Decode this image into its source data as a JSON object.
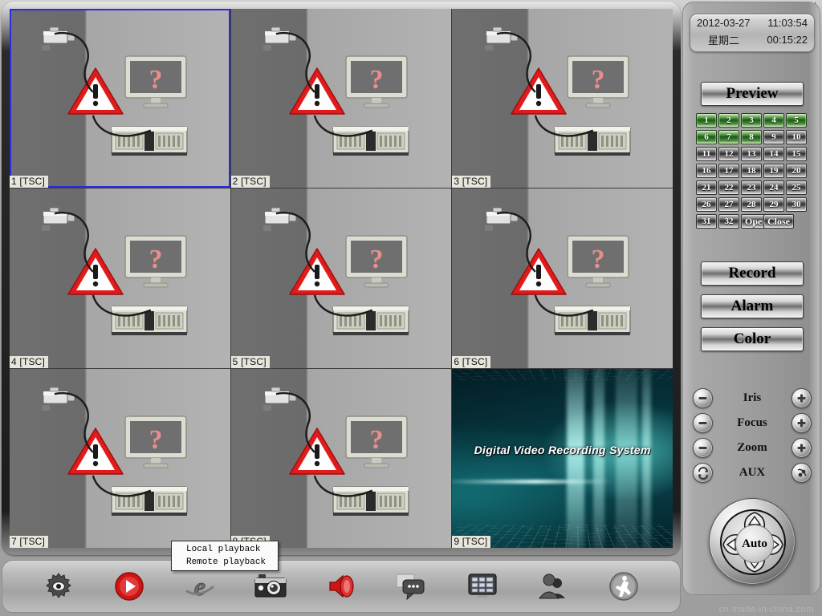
{
  "window": {
    "minimize_icon": "minimize-icon"
  },
  "clock": {
    "date": "2012-03-27",
    "time": "11:03:54",
    "weekday": "星期二",
    "elapsed": "00:15:22"
  },
  "sidebar": {
    "preview_label": "Preview",
    "record_label": "Record",
    "alarm_label": "Alarm",
    "color_label": "Color",
    "channels": [
      {
        "label": "1",
        "active": true
      },
      {
        "label": "2",
        "active": true
      },
      {
        "label": "3",
        "active": true
      },
      {
        "label": "4",
        "active": true
      },
      {
        "label": "5",
        "active": true
      },
      {
        "label": "6",
        "active": true
      },
      {
        "label": "7",
        "active": true
      },
      {
        "label": "8",
        "active": true
      },
      {
        "label": "9",
        "active": false
      },
      {
        "label": "10",
        "active": false
      },
      {
        "label": "11",
        "active": false
      },
      {
        "label": "12",
        "active": false
      },
      {
        "label": "13",
        "active": false
      },
      {
        "label": "14",
        "active": false
      },
      {
        "label": "15",
        "active": false
      },
      {
        "label": "16",
        "active": false
      },
      {
        "label": "17",
        "active": false
      },
      {
        "label": "18",
        "active": false
      },
      {
        "label": "19",
        "active": false
      },
      {
        "label": "20",
        "active": false
      },
      {
        "label": "21",
        "active": false
      },
      {
        "label": "22",
        "active": false
      },
      {
        "label": "23",
        "active": false
      },
      {
        "label": "24",
        "active": false
      },
      {
        "label": "25",
        "active": false
      },
      {
        "label": "26",
        "active": false
      },
      {
        "label": "27",
        "active": false
      },
      {
        "label": "28",
        "active": false
      },
      {
        "label": "29",
        "active": false
      },
      {
        "label": "30",
        "active": false
      },
      {
        "label": "31",
        "active": false
      },
      {
        "label": "32",
        "active": false
      }
    ],
    "open_label": "Open",
    "close_label": "Close",
    "ptz": [
      {
        "label": "Iris",
        "minus_icon": "minus-circle-icon",
        "plus_icon": "plus-circle-icon"
      },
      {
        "label": "Focus",
        "minus_icon": "minus-circle-icon",
        "plus_icon": "plus-circle-icon"
      },
      {
        "label": "Zoom",
        "minus_icon": "minus-circle-icon",
        "plus_icon": "plus-circle-icon"
      },
      {
        "label": "AUX",
        "minus_icon": "aux-refresh-icon",
        "plus_icon": "aux-preset-icon"
      }
    ],
    "dpad": {
      "auto_label": "Auto",
      "up_icon": "arrow-up-icon",
      "down_icon": "arrow-down-icon",
      "left_icon": "arrow-left-icon",
      "right_icon": "arrow-right-icon"
    }
  },
  "video": {
    "selected_pane": 1,
    "panes": [
      {
        "label": "1 [TSC]",
        "state": "no-signal"
      },
      {
        "label": "2 [TSC]",
        "state": "no-signal"
      },
      {
        "label": "3 [TSC]",
        "state": "no-signal"
      },
      {
        "label": "4 [TSC]",
        "state": "no-signal"
      },
      {
        "label": "5 [TSC]",
        "state": "no-signal"
      },
      {
        "label": "6 [TSC]",
        "state": "no-signal"
      },
      {
        "label": "7 [TSC]",
        "state": "no-signal"
      },
      {
        "label": "8 [TSC]",
        "state": "no-signal"
      },
      {
        "label": "9 [TSC]",
        "state": "live",
        "splash_text": "Digital Video Recording System"
      }
    ]
  },
  "context_menu": {
    "items": [
      {
        "label": "Local playback"
      },
      {
        "label": "Remote playback"
      }
    ]
  },
  "toolbar": {
    "items": [
      {
        "name": "settings-eye-icon"
      },
      {
        "name": "play-icon"
      },
      {
        "name": "internet-explorer-icon"
      },
      {
        "name": "snapshot-camera-icon"
      },
      {
        "name": "audio-speaker-icon"
      },
      {
        "name": "chat-bubble-icon"
      },
      {
        "name": "channel-grid-icon"
      },
      {
        "name": "users-icon"
      },
      {
        "name": "exit-running-man-icon"
      }
    ]
  },
  "watermark": "cn.made-in-china.com"
}
